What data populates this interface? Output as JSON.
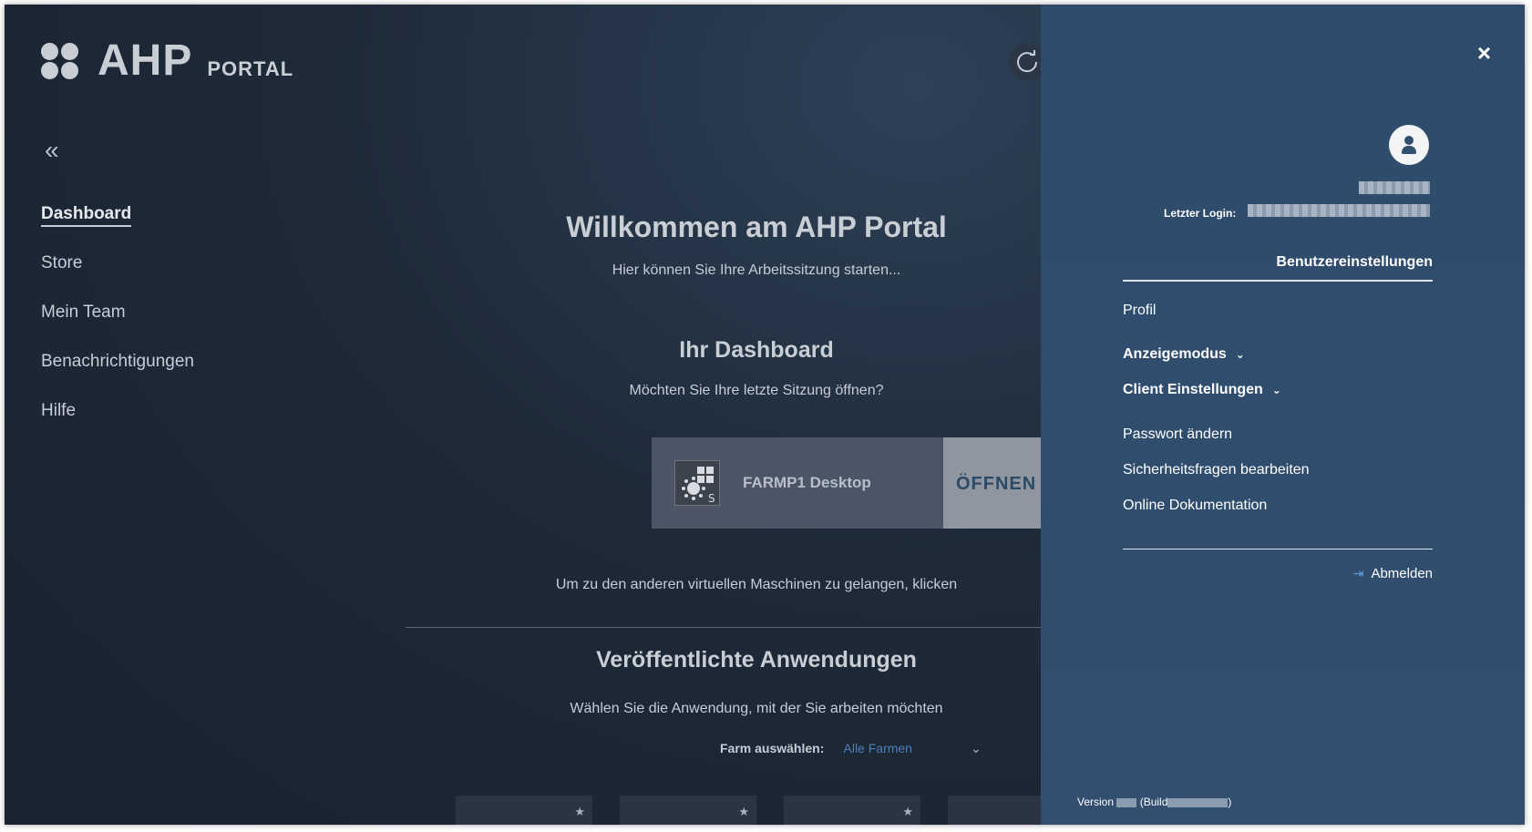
{
  "brand": {
    "name": "AHP",
    "subtitle": "PORTAL"
  },
  "sidebar": {
    "collapse": "«",
    "items": [
      {
        "label": "Dashboard",
        "active": true
      },
      {
        "label": "Store"
      },
      {
        "label": "Mein Team"
      },
      {
        "label": "Benachrichtigungen"
      },
      {
        "label": "Hilfe"
      }
    ]
  },
  "main": {
    "welcome": "Willkommen am AHP Portal",
    "welcome_sub": "Hier können Sie Ihre Arbeitssitzung starten...",
    "dashboard_title": "Ihr Dashboard",
    "dashboard_sub": "Möchten Sie Ihre letzte Sitzung öffnen?",
    "session": {
      "name": "FARMP1 Desktop",
      "open_label": "ÖFFNEN"
    },
    "other_vms": "Um zu den anderen virtuellen Maschinen zu gelangen, klicken",
    "apps_title": "Veröffentlichte Anwendungen",
    "apps_sub": "Wählen Sie die Anwendung, mit der Sie arbeiten möchten",
    "farm_label": "Farm auswählen:",
    "farm_value": "Alle Farmen"
  },
  "drawer": {
    "close": "×",
    "last_login_label": "Letzter Login:",
    "settings_title": "Benutzereinstellungen",
    "items": [
      {
        "label": "Profil"
      },
      {
        "label": "Anzeigemodus"
      },
      {
        "label": "Client Einstellungen"
      },
      {
        "label": "Passwort ändern"
      },
      {
        "label": "Sicherheitsfragen bearbeiten"
      },
      {
        "label": "Online Dokumentation"
      }
    ],
    "logout": "Abmelden",
    "version_label": "Version",
    "build_label": "(Build",
    "build_close": ")"
  },
  "colors": {
    "drawer": "#324f70",
    "accent": "#4f7fb8"
  },
  "icons": [
    "refresh-icon",
    "close-icon",
    "user-icon",
    "logout-icon",
    "chevron-down-icon",
    "star-icon"
  ]
}
